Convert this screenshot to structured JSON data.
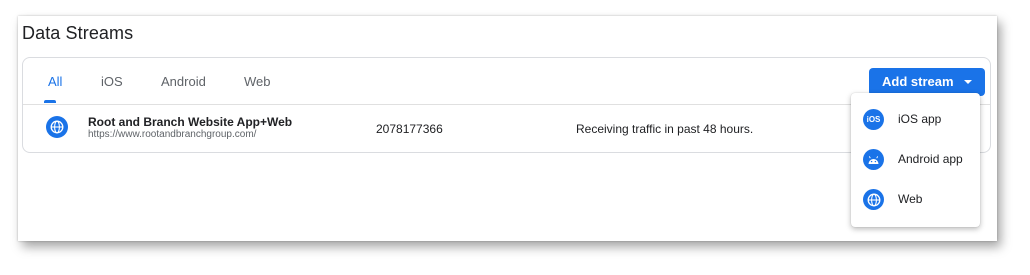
{
  "page": {
    "title": "Data Streams"
  },
  "tabs": [
    {
      "label": "All",
      "active": true
    },
    {
      "label": "iOS",
      "active": false
    },
    {
      "label": "Android",
      "active": false
    },
    {
      "label": "Web",
      "active": false
    }
  ],
  "add_stream": {
    "label": "Add stream",
    "icon": "arrow-drop-down-icon"
  },
  "streams": [
    {
      "icon": "globe-icon",
      "name": "Root and Branch Website App+Web",
      "url": "https://www.rootandbranchgroup.com/",
      "id": "2078177366",
      "status": "Receiving traffic in past 48 hours."
    }
  ],
  "menu": {
    "items": [
      {
        "label": "iOS app",
        "icon": "ios-icon",
        "glyph": "iOS"
      },
      {
        "label": "Android app",
        "icon": "android-icon"
      },
      {
        "label": "Web",
        "icon": "globe-icon"
      }
    ]
  },
  "colors": {
    "accent": "#1a73e8",
    "text": "#202124",
    "muted": "#5f6368",
    "border": "#dadce0"
  }
}
